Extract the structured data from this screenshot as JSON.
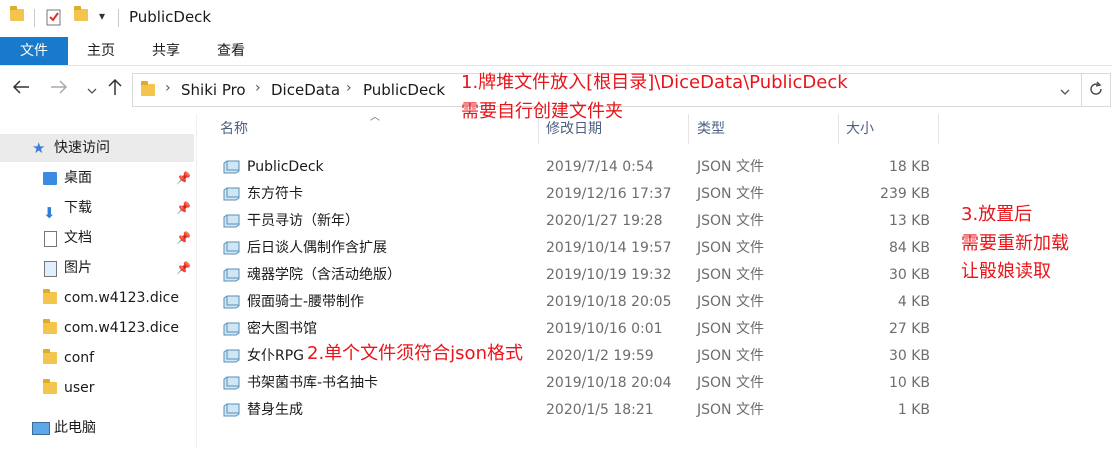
{
  "window": {
    "title": "PublicDeck",
    "qa_dropdown": "▾"
  },
  "ribbon": {
    "tabs": [
      {
        "label": "文件",
        "active": true
      },
      {
        "label": "主页"
      },
      {
        "label": "共享"
      },
      {
        "label": "查看"
      }
    ]
  },
  "address": {
    "crumbs": [
      "Shiki Pro",
      "DiceData",
      "PublicDeck"
    ],
    "separator": "›"
  },
  "nav": {
    "quick_access": "快速访问",
    "items": [
      {
        "label": "桌面",
        "icon": "desktop-folder-icon",
        "pinned": true
      },
      {
        "label": "下载",
        "icon": "download-folder-icon",
        "pinned": true
      },
      {
        "label": "文档",
        "icon": "documents-folder-icon",
        "pinned": true
      },
      {
        "label": "图片",
        "icon": "pictures-folder-icon",
        "pinned": true
      },
      {
        "label": "com.w4123.dice",
        "icon": "folder-icon"
      },
      {
        "label": "com.w4123.dice",
        "icon": "folder-icon"
      },
      {
        "label": "conf",
        "icon": "folder-icon"
      },
      {
        "label": "user",
        "icon": "folder-icon"
      }
    ],
    "this_pc": "此电脑"
  },
  "columns": {
    "name": "名称",
    "date": "修改日期",
    "type": "类型",
    "size": "大小"
  },
  "files": [
    {
      "name": "PublicDeck",
      "date": "2019/7/14 0:54",
      "type": "JSON 文件",
      "size": "18 KB"
    },
    {
      "name": "东方符卡",
      "date": "2019/12/16 17:37",
      "type": "JSON 文件",
      "size": "239 KB"
    },
    {
      "name": "干员寻访（新年）",
      "date": "2020/1/27 19:28",
      "type": "JSON 文件",
      "size": "13 KB"
    },
    {
      "name": "后日谈人偶制作含扩展",
      "date": "2019/10/14 19:57",
      "type": "JSON 文件",
      "size": "84 KB"
    },
    {
      "name": "魂器学院（含活动绝版）",
      "date": "2019/10/19 19:32",
      "type": "JSON 文件",
      "size": "30 KB"
    },
    {
      "name": "假面骑士-腰带制作",
      "date": "2019/10/18 20:05",
      "type": "JSON 文件",
      "size": "4 KB"
    },
    {
      "name": "密大图书馆",
      "date": "2019/10/16 0:01",
      "type": "JSON 文件",
      "size": "27 KB"
    },
    {
      "name": "女仆RPG",
      "date": "2020/1/2 19:59",
      "type": "JSON 文件",
      "size": "30 KB"
    },
    {
      "name": "书架菌书库-书名抽卡",
      "date": "2019/10/18 20:04",
      "type": "JSON 文件",
      "size": "10 KB"
    },
    {
      "name": "替身生成",
      "date": "2020/1/5 18:21",
      "type": "JSON 文件",
      "size": "1 KB"
    }
  ],
  "annotations": {
    "a1_line1": "1.牌堆文件放入[根目录]\\DiceData\\PublicDeck",
    "a1_line2": "需要自行创建文件夹",
    "a2": "2.单个文件须符合json格式",
    "a3_line1": "3.放置后",
    "a3_line2": "需要重新加载",
    "a3_line3": "让骰娘读取"
  },
  "colors": {
    "accent": "#1979ca",
    "annotation": "#e8141a",
    "folder": "#f3c54c"
  }
}
